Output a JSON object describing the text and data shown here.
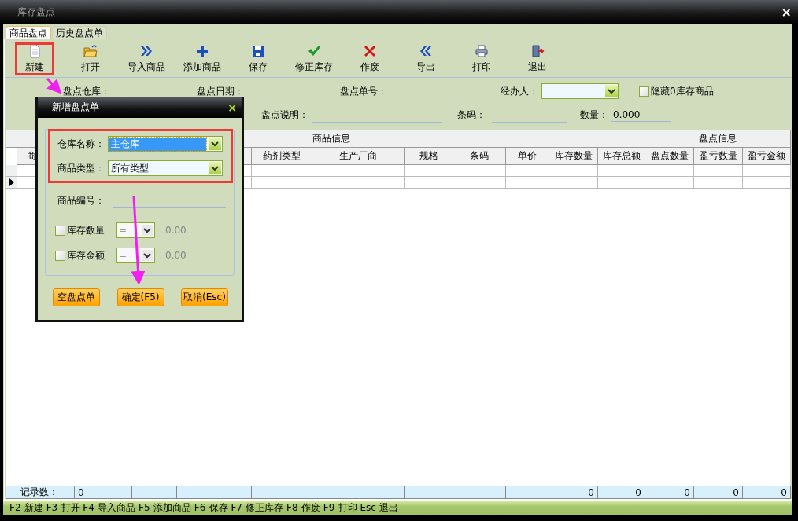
{
  "window": {
    "title": "库存盘点",
    "close": "×"
  },
  "tabs": [
    {
      "label": "商品盘点",
      "selected": true
    },
    {
      "label": "历史盘点单",
      "selected": false
    }
  ],
  "toolbar": [
    {
      "label": "新建",
      "kind": "new",
      "highlighted": true
    },
    {
      "label": "打开",
      "kind": "open",
      "highlighted": false
    },
    {
      "label": "导入商品",
      "kind": "import",
      "highlighted": false
    },
    {
      "label": "添加商品",
      "kind": "add",
      "highlighted": false
    },
    {
      "label": "保存",
      "kind": "save",
      "highlighted": false
    },
    {
      "label": "修正库存",
      "kind": "check",
      "highlighted": false
    },
    {
      "label": "作废",
      "kind": "void",
      "highlighted": false
    },
    {
      "label": "导出",
      "kind": "export",
      "highlighted": false
    },
    {
      "label": "打印",
      "kind": "print",
      "highlighted": false
    },
    {
      "label": "退出",
      "kind": "exit",
      "highlighted": false
    }
  ],
  "form": {
    "warehouse_label": "盘点仓库：",
    "date_label": "盘点日期：",
    "order_no_label": "盘点单号：",
    "handler_label": "经办人：",
    "hide_zero": {
      "label": "隐藏0库存商品",
      "checked": false
    },
    "note_label": "盘点说明：",
    "barcode_label": "条码：",
    "quantity_label": "数量：",
    "quantity_value": "0.000"
  },
  "grid": {
    "groups": [
      {
        "label": "商品信息",
        "columns": [
          "商",
          null,
          null,
          null,
          "药剂类型",
          "生产厂商",
          "规格",
          "条码",
          "单价",
          "库存数量",
          "库存总额"
        ]
      },
      {
        "label": "盘点信息",
        "columns": [
          "盘点数量",
          "盈亏数量",
          "盈亏金额"
        ]
      }
    ],
    "rows": [
      {
        "current": false
      },
      {
        "current": true
      }
    ],
    "footer": {
      "label": "记录数：",
      "count": "0",
      "totals": [
        "0",
        "0",
        "0",
        "0",
        "0"
      ]
    }
  },
  "status_bar": "F2-新建 F3-打开 F4-导入商品 F5-添加商品 F6-保存 F7-修正库存 F8-作废 F9-打印 Esc-退出",
  "dialog": {
    "title": "新增盘点单",
    "close": "×",
    "highlighted_fields": [
      {
        "kind": "select",
        "label": "仓库名称：",
        "value": "主仓库",
        "value_highlighted": true
      },
      {
        "kind": "select",
        "label": "商品类型：",
        "value": "所有类型",
        "value_highlighted": false
      }
    ],
    "fields": [
      {
        "kind": "text",
        "label": "商品编号："
      },
      {
        "kind": "filter",
        "label": "库存数量",
        "checked": false,
        "operator": "=",
        "value": "0.00",
        "disabled": true
      },
      {
        "kind": "filter",
        "label": "库存金额",
        "checked": false,
        "operator": "=",
        "value": "0.00",
        "disabled": true
      }
    ],
    "buttons": [
      "空盘点单",
      "确定(F5)",
      "取消(Esc)"
    ]
  }
}
